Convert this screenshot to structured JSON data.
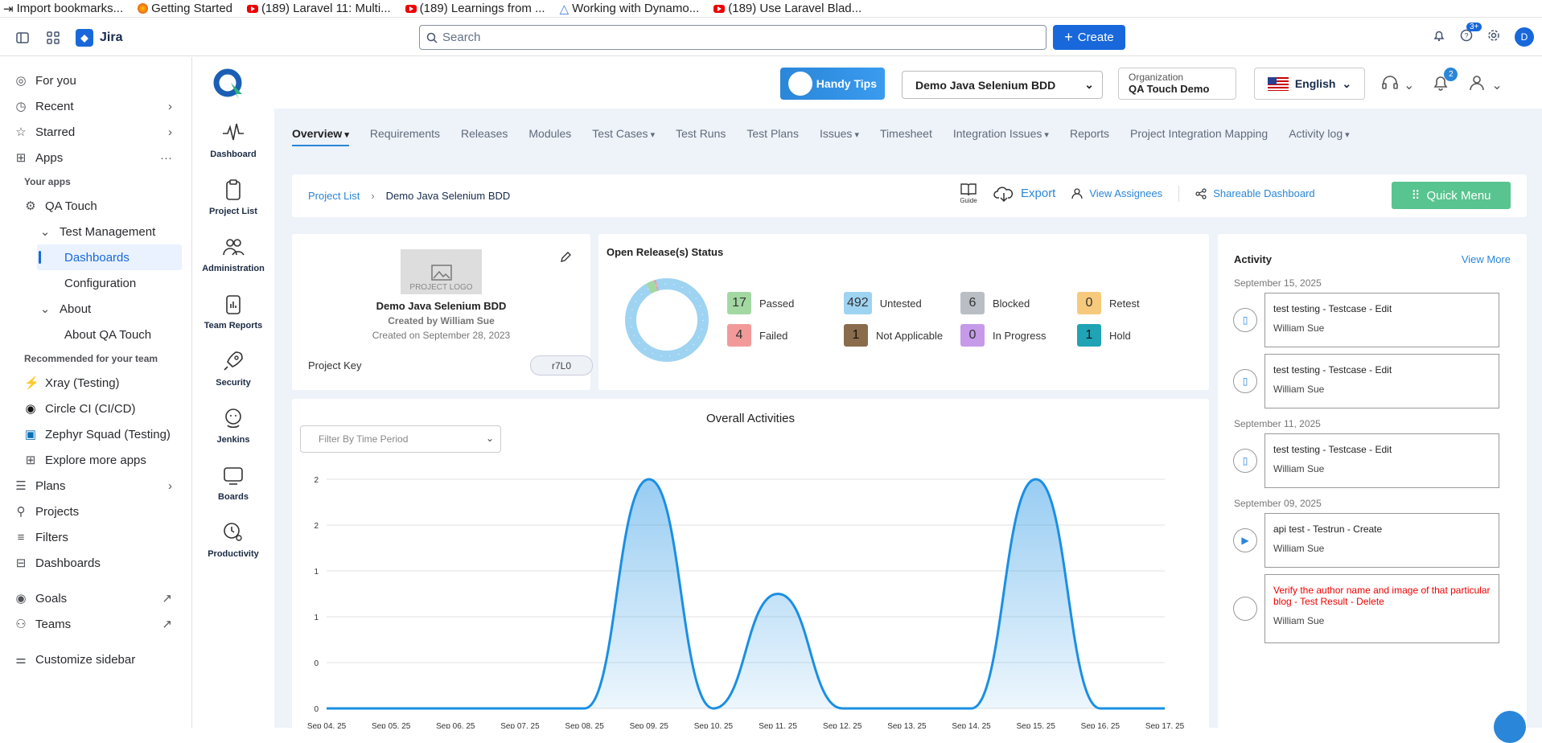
{
  "bookmarks": [
    {
      "label": "Import bookmarks...",
      "icon": "import-icon"
    },
    {
      "label": "Getting Started",
      "icon": "firefox-icon"
    },
    {
      "label": "(189) Laravel 11: Multi...",
      "icon": "youtube-icon"
    },
    {
      "label": "(189) Learnings from ...",
      "icon": "youtube-icon"
    },
    {
      "label": "Working with Dynamo...",
      "icon": "triangle-icon"
    },
    {
      "label": "(189) Use Laravel Blad...",
      "icon": "youtube-icon"
    }
  ],
  "topbar": {
    "app_name": "Jira",
    "search_placeholder": "Search",
    "create_label": "Create",
    "help_badge": "3+",
    "avatar_initial": "D"
  },
  "sidebar": {
    "for_you": "For you",
    "recent": "Recent",
    "starred": "Starred",
    "apps": "Apps",
    "your_apps": "Your apps",
    "qa_touch": "QA Touch",
    "test_management": "Test Management",
    "dashboards_active": "Dashboards",
    "configuration": "Configuration",
    "about": "About",
    "about_qa_touch": "About QA Touch",
    "recommended": "Recommended for your team",
    "xray": "Xray (Testing)",
    "circleci": "Circle CI (CI/CD)",
    "zephyr": "Zephyr Squad (Testing)",
    "explore": "Explore more apps",
    "plans": "Plans",
    "projects": "Projects",
    "filters": "Filters",
    "dashboards": "Dashboards",
    "goals": "Goals",
    "teams": "Teams",
    "customize": "Customize sidebar"
  },
  "rail": [
    {
      "label": "Dashboard",
      "icon": "pulse-icon"
    },
    {
      "label": "Project List",
      "icon": "clipboard-icon"
    },
    {
      "label": "Administration",
      "icon": "users-icon"
    },
    {
      "label": "Team Reports",
      "icon": "report-icon"
    },
    {
      "label": "Security",
      "icon": "rocket-icon"
    },
    {
      "label": "Jenkins",
      "icon": "jenkins-icon"
    },
    {
      "label": "Boards",
      "icon": "board-icon"
    },
    {
      "label": "Productivity",
      "icon": "clock-gear-icon"
    }
  ],
  "header": {
    "handy_tips": "Handy Tips",
    "project": "Demo Java Selenium BDD",
    "org_label": "Organization",
    "org_value": "QA Touch Demo",
    "language": "English",
    "notif_count": "2"
  },
  "tabs": [
    "Overview",
    "Requirements",
    "Releases",
    "Modules",
    "Test Cases",
    "Test Runs",
    "Test Plans",
    "Issues",
    "Timesheet",
    "Integration Issues",
    "Reports",
    "Project Integration Mapping",
    "Activity log"
  ],
  "crumb": {
    "link": "Project List",
    "current": "Demo Java Selenium BDD",
    "guide": "Guide",
    "export": "Export",
    "view_assignees": "View Assignees",
    "shareable": "Shareable Dashboard",
    "quick_menu": "Quick Menu"
  },
  "project_card": {
    "logo_text": "PROJECT LOGO",
    "name": "Demo Java Selenium BDD",
    "created_by": "Created by William Sue",
    "created_on": "Created on September 28, 2023",
    "key_label": "Project Key",
    "key_value": "r7L0"
  },
  "release": {
    "title": "Open Release(s) Status",
    "stats": [
      {
        "n": "17",
        "label": "Passed",
        "color": "#a3d8a3"
      },
      {
        "n": "492",
        "label": "Untested",
        "color": "#9ed3f2"
      },
      {
        "n": "6",
        "label": "Blocked",
        "color": "#b8bec4"
      },
      {
        "n": "0",
        "label": "Retest",
        "color": "#f7c97c"
      },
      {
        "n": "4",
        "label": "Failed",
        "color": "#f29a9a"
      },
      {
        "n": "1",
        "label": "Not Applicable",
        "color": "#8a6c4c"
      },
      {
        "n": "0",
        "label": "In Progress",
        "color": "#c59ae8"
      },
      {
        "n": "1",
        "label": "Hold",
        "color": "#20a3b5"
      }
    ]
  },
  "activity": {
    "title": "Activity",
    "view_more": "View More",
    "groups": [
      {
        "date": "September 15, 2025",
        "items": [
          {
            "text": "test testing - Testcase - Edit",
            "user": "William Sue",
            "icon": "doc-icon"
          },
          {
            "text": "test testing - Testcase - Edit",
            "user": "William Sue",
            "icon": "doc-icon"
          }
        ]
      },
      {
        "date": "September 11, 2025",
        "items": [
          {
            "text": "test testing - Testcase - Edit",
            "user": "William Sue",
            "icon": "doc-icon"
          }
        ]
      },
      {
        "date": "September 09, 2025",
        "items": [
          {
            "text": "api test - Testrun - Create",
            "user": "William Sue",
            "icon": "play-icon"
          },
          {
            "text": "Verify the author name and image of that particular blog - Test Result - Delete",
            "user": "William Sue",
            "icon": "circle-icon"
          }
        ]
      }
    ]
  },
  "chart_data": {
    "type": "area",
    "title": "Overall Activities",
    "filter_placeholder": "Filter By Time Period",
    "x": [
      "Sep 04, 25",
      "Sep 05, 25",
      "Sep 06, 25",
      "Sep 07, 25",
      "Sep 08, 25",
      "Sep 09, 25",
      "Sep 10, 25",
      "Sep 11, 25",
      "Sep 12, 25",
      "Sep 13, 25",
      "Sep 14, 25",
      "Sep 15, 25",
      "Sep 16, 25",
      "Sep 17, 25"
    ],
    "values": [
      0,
      0,
      0,
      0,
      0,
      2,
      0,
      1,
      0,
      0,
      0,
      2,
      0,
      0
    ],
    "ytick_labels": [
      "0",
      "0",
      "1",
      "1",
      "2",
      "2"
    ],
    "ytick_values": [
      0,
      0.4,
      0.8,
      1.2,
      1.6,
      2
    ],
    "ylim": [
      0,
      2
    ],
    "grid": true,
    "color": "#1a8fe3"
  }
}
